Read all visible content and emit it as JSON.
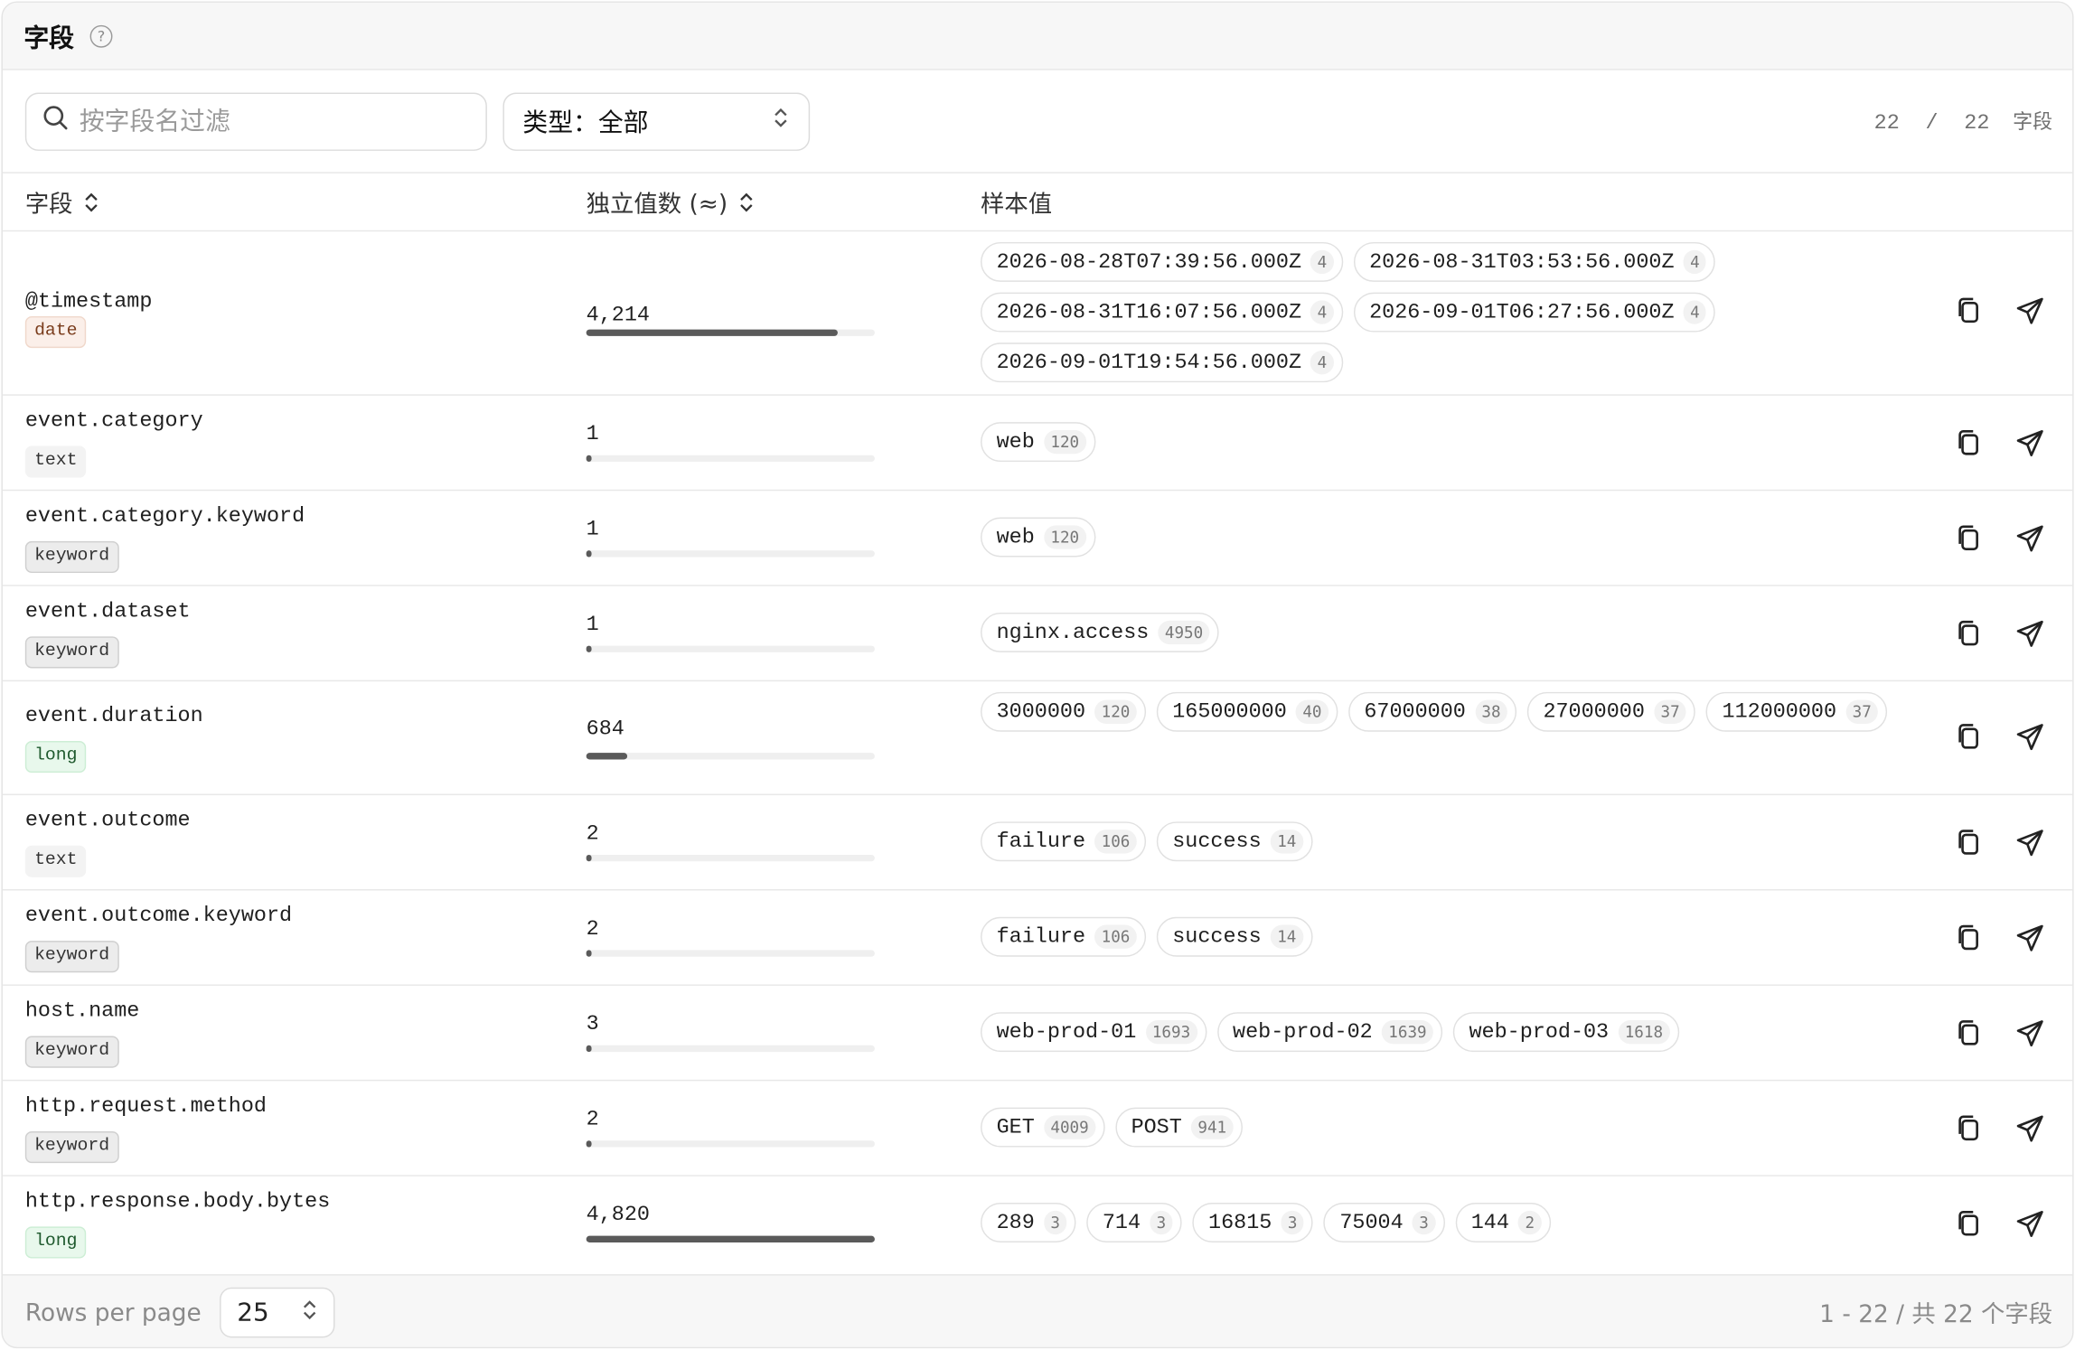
{
  "header": {
    "title": "字段",
    "help_icon": "question-circle-icon"
  },
  "toolbar": {
    "search_placeholder": "按字段名过滤",
    "type_filter_label": "类型：全部",
    "count_shown": "22",
    "count_sep": "/",
    "count_total": "22",
    "count_unit": "字段"
  },
  "table": {
    "columns": {
      "field": "字段",
      "cardinality": "独立值数 (≈)",
      "samples": "样本值"
    },
    "rows": [
      {
        "name": "@timestamp",
        "type": "date",
        "cardinality": "4,214",
        "fill_fraction": 0.87,
        "samples": [
          {
            "value": "2026-08-28T07:39:56.000Z",
            "count": "4"
          },
          {
            "value": "2026-08-31T03:53:56.000Z",
            "count": "4"
          },
          {
            "value": "2026-08-31T16:07:56.000Z",
            "count": "4"
          },
          {
            "value": "2026-09-01T06:27:56.000Z",
            "count": "4"
          },
          {
            "value": "2026-09-01T19:54:56.000Z",
            "count": "4"
          }
        ]
      },
      {
        "name": "event.category",
        "type": "text",
        "cardinality": "1",
        "fill_fraction": 0.0002,
        "samples": [
          {
            "value": "web",
            "count": "120"
          }
        ]
      },
      {
        "name": "event.category.keyword",
        "type": "keyword",
        "cardinality": "1",
        "fill_fraction": 0.0002,
        "samples": [
          {
            "value": "web",
            "count": "120"
          }
        ]
      },
      {
        "name": "event.dataset",
        "type": "keyword",
        "cardinality": "1",
        "fill_fraction": 0.0002,
        "samples": [
          {
            "value": "nginx.access",
            "count": "4950"
          }
        ]
      },
      {
        "name": "event.duration",
        "type": "long",
        "cardinality": "684",
        "fill_fraction": 0.14,
        "samples": [
          {
            "value": "3000000",
            "count": "120"
          },
          {
            "value": "165000000",
            "count": "40"
          },
          {
            "value": "67000000",
            "count": "38"
          },
          {
            "value": "27000000",
            "count": "37"
          },
          {
            "value": "112000000",
            "count": "37"
          }
        ]
      },
      {
        "name": "event.outcome",
        "type": "text",
        "cardinality": "2",
        "fill_fraction": 0.0004,
        "samples": [
          {
            "value": "failure",
            "count": "106"
          },
          {
            "value": "success",
            "count": "14"
          }
        ]
      },
      {
        "name": "event.outcome.keyword",
        "type": "keyword",
        "cardinality": "2",
        "fill_fraction": 0.0004,
        "samples": [
          {
            "value": "failure",
            "count": "106"
          },
          {
            "value": "success",
            "count": "14"
          }
        ]
      },
      {
        "name": "host.name",
        "type": "keyword",
        "cardinality": "3",
        "fill_fraction": 0.0006,
        "samples": [
          {
            "value": "web-prod-01",
            "count": "1693"
          },
          {
            "value": "web-prod-02",
            "count": "1639"
          },
          {
            "value": "web-prod-03",
            "count": "1618"
          }
        ]
      },
      {
        "name": "http.request.method",
        "type": "keyword",
        "cardinality": "2",
        "fill_fraction": 0.0004,
        "samples": [
          {
            "value": "GET",
            "count": "4009"
          },
          {
            "value": "POST",
            "count": "941"
          }
        ]
      },
      {
        "name": "http.response.body.bytes",
        "type": "long",
        "cardinality": "4,820",
        "fill_fraction": 1.0,
        "samples": [
          {
            "value": "289",
            "count": "3"
          },
          {
            "value": "714",
            "count": "3"
          },
          {
            "value": "16815",
            "count": "3"
          },
          {
            "value": "75004",
            "count": "3"
          },
          {
            "value": "144",
            "count": "2"
          }
        ]
      }
    ],
    "row_actions": [
      "copy-icon",
      "send-icon"
    ]
  },
  "footer": {
    "rows_per_page_label": "Rows per page",
    "rows_per_page_value": "25",
    "range_text": "1 - 22 / 共 22 个字段"
  },
  "colors": {
    "bar_fill": "#5a5a5a",
    "date_badge": "#fbefe9",
    "long_badge": "#e8f8ec",
    "keyword_badge": "#ececec"
  }
}
